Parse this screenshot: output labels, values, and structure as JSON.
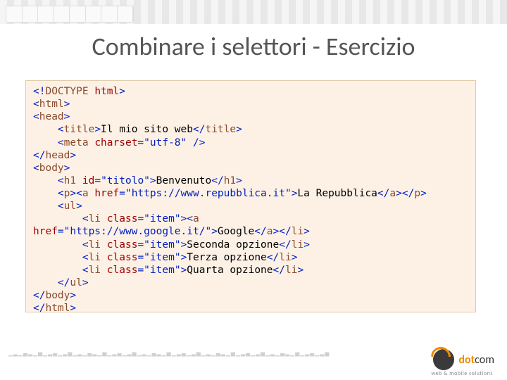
{
  "title": "Combinare i selettori - Esercizio",
  "c": {
    "doctype": "DOCTYPE",
    "html": "html",
    "head": "head",
    "titleTag": "title",
    "siteTitle": "Il mio sito web",
    "meta": "meta",
    "charset": "charset",
    "utf8": "\"utf-8\"",
    "body": "body",
    "h1": "h1",
    "id": "id",
    "titolo": "\"titolo\"",
    "benvenuto": "Benvenuto",
    "p": "p",
    "a": "a",
    "href": "href",
    "urlRep": "\"https://www.repubblica.it\"",
    "repubblica": "La Repubblica",
    "ul": "ul",
    "li": "li",
    "class": "class",
    "item": "\"item\"",
    "urlGoogle": "\"https://www.google.it/\"",
    "google": "Google",
    "opt2": "Seconda opzione",
    "opt3": "Terza opzione",
    "opt4": "Quarta opzione"
  },
  "logo": {
    "part1": "dot",
    "part2": "com",
    "sub": "web & mobile solutions"
  }
}
